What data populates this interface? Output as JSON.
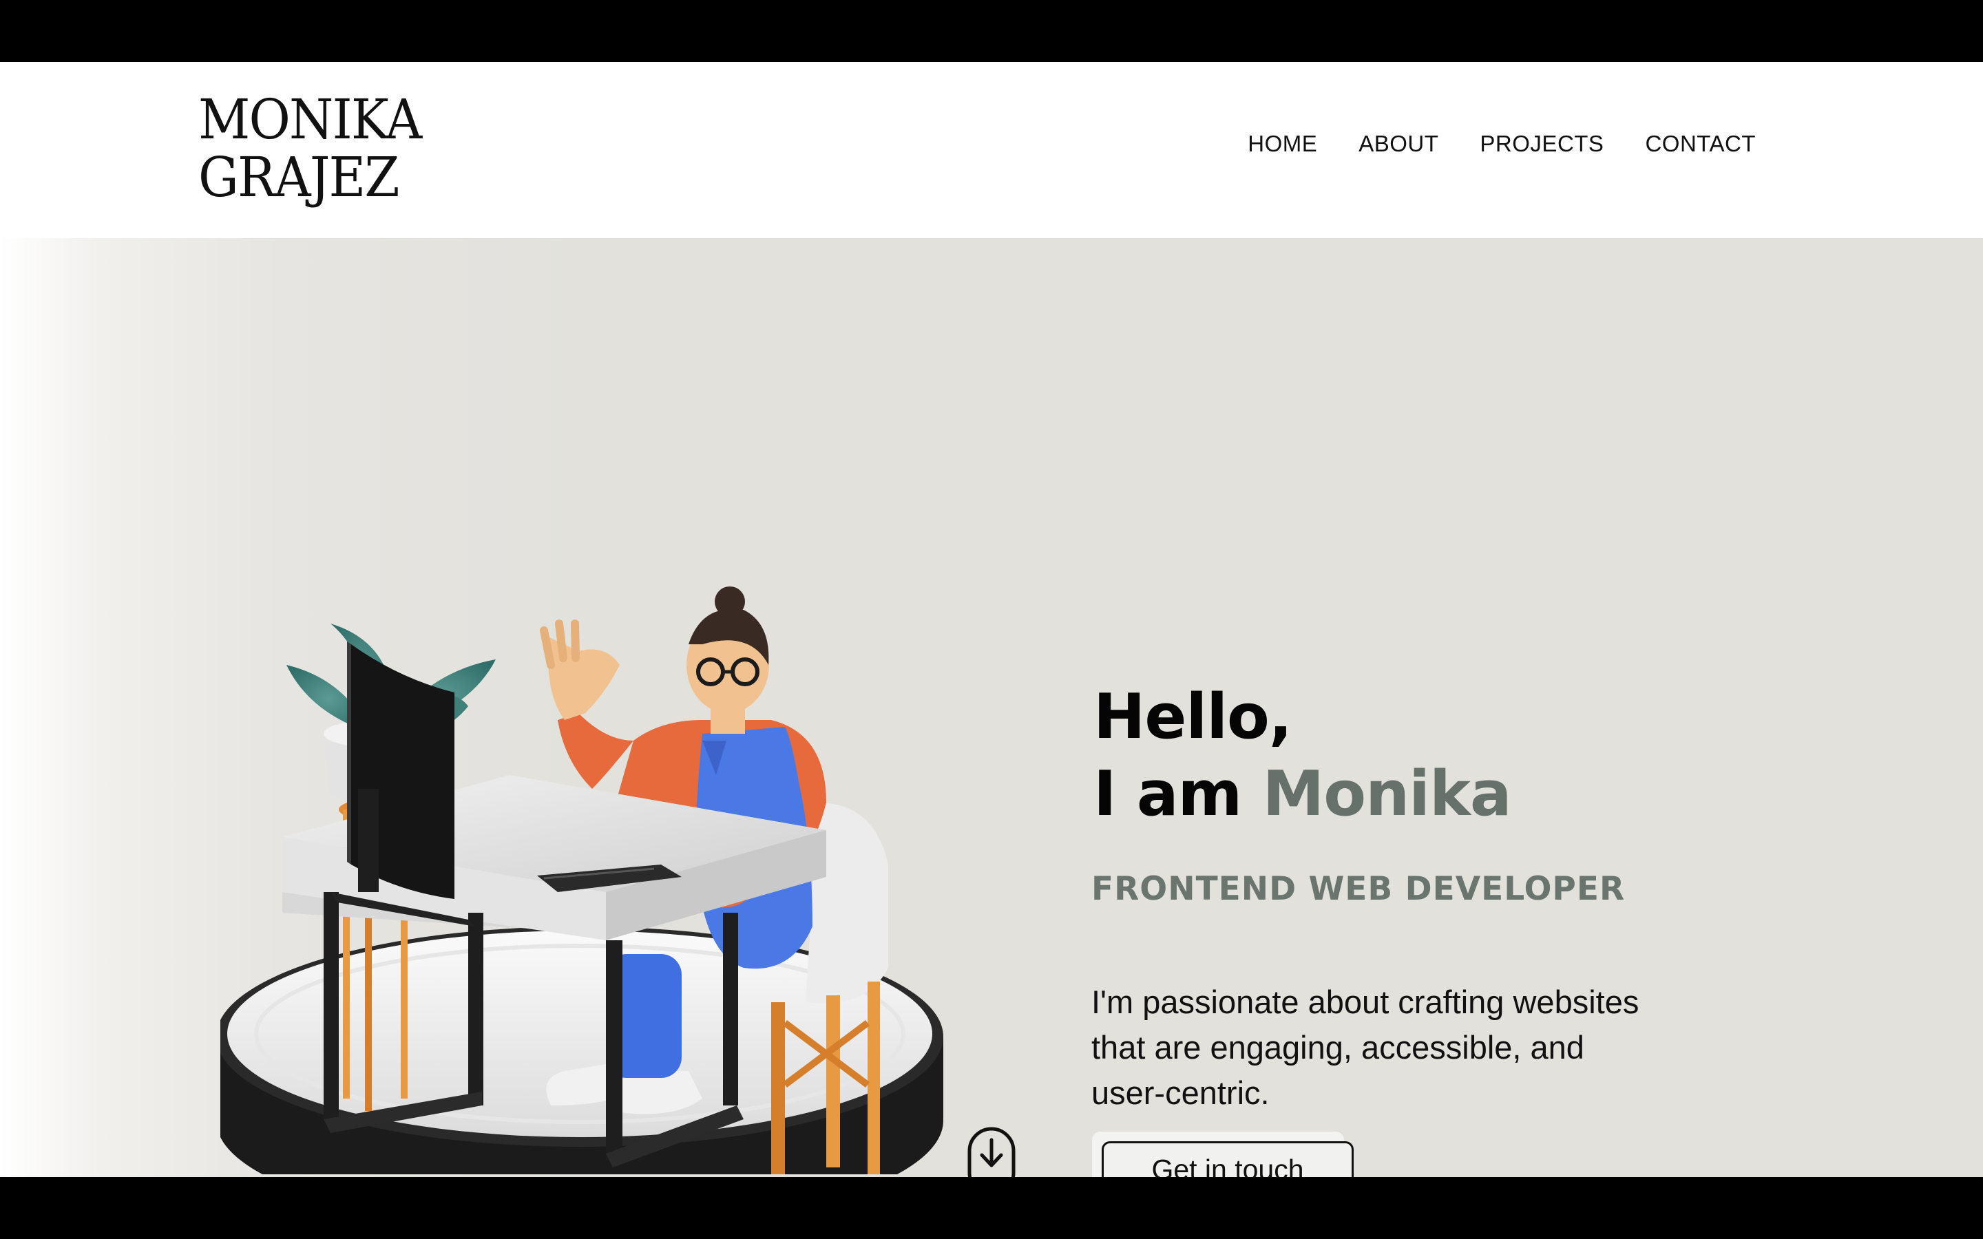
{
  "header": {
    "logo_line1": "MONIKA",
    "logo_line2": "GRAJEZ",
    "nav": [
      "HOME",
      "ABOUT",
      "PROJECTS",
      "CONTACT"
    ]
  },
  "hero": {
    "greeting": "Hello,",
    "intro_prefix": "I am ",
    "name": "Monika",
    "role": "FRONTEND WEB DEVELOPER",
    "description": "I'm passionate about crafting websites that are engaging, accessible, and user-centric.",
    "cta_label": "Get in touch"
  },
  "colors": {
    "header_bg": "#ffffff",
    "hero_bg": "#e2e1dc",
    "accent": "#66716c",
    "text": "#111111",
    "frame": "#000000"
  },
  "icons": {
    "scroll": "mouse-scroll-down-icon",
    "illustration": "developer-at-desk-illustration"
  }
}
